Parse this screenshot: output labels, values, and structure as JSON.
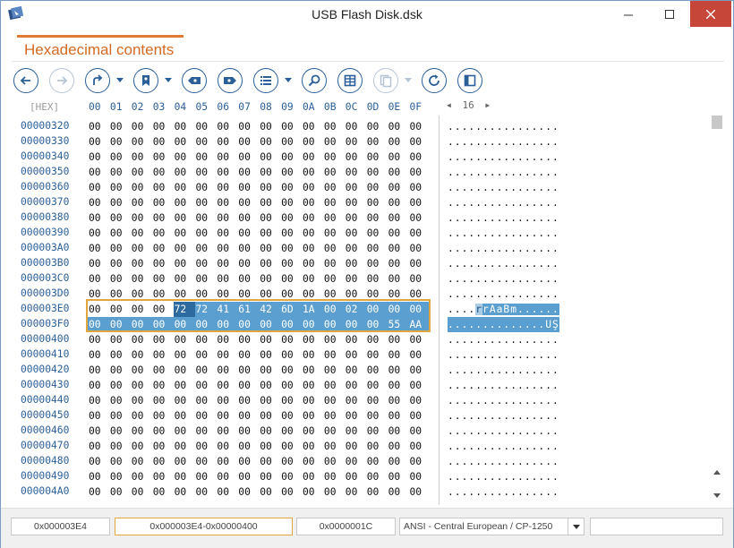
{
  "window": {
    "title": "USB Flash Disk.dsk"
  },
  "header": {
    "tab_label": "Hexadecimal contents"
  },
  "toolbar": {
    "buttons": [
      {
        "name": "back-button",
        "icon": "arrow-left-icon"
      },
      {
        "name": "forward-button",
        "icon": "arrow-right-icon",
        "disabled": true
      },
      {
        "name": "goto-button",
        "icon": "redirect-arrow-icon"
      },
      {
        "name": "bookmark-button",
        "icon": "bookmark-icon"
      },
      {
        "name": "previous-bookmark-button",
        "icon": "bookmark-prev-icon"
      },
      {
        "name": "next-bookmark-button",
        "icon": "bookmark-next-icon"
      },
      {
        "name": "list-button",
        "icon": "list-icon"
      },
      {
        "name": "find-button",
        "icon": "magnifier-icon"
      },
      {
        "name": "columns-button",
        "icon": "grid-icon"
      },
      {
        "name": "copy-button",
        "icon": "copy-icon",
        "disabled": true
      },
      {
        "name": "refresh-button",
        "icon": "refresh-icon"
      },
      {
        "name": "panel-button",
        "icon": "panel-icon"
      }
    ]
  },
  "hex": {
    "hex_label": "[HEX]",
    "columns": [
      "00",
      "01",
      "02",
      "03",
      "04",
      "05",
      "06",
      "07",
      "08",
      "09",
      "0A",
      "0B",
      "0C",
      "0D",
      "0E",
      "0F"
    ],
    "page_number": "16",
    "rows": [
      {
        "addr": "00000320",
        "bytes": [
          "00",
          "00",
          "00",
          "00",
          "00",
          "00",
          "00",
          "00",
          "00",
          "00",
          "00",
          "00",
          "00",
          "00",
          "00",
          "00"
        ],
        "ascii": "................"
      },
      {
        "addr": "00000330",
        "bytes": [
          "00",
          "00",
          "00",
          "00",
          "00",
          "00",
          "00",
          "00",
          "00",
          "00",
          "00",
          "00",
          "00",
          "00",
          "00",
          "00"
        ],
        "ascii": "................"
      },
      {
        "addr": "00000340",
        "bytes": [
          "00",
          "00",
          "00",
          "00",
          "00",
          "00",
          "00",
          "00",
          "00",
          "00",
          "00",
          "00",
          "00",
          "00",
          "00",
          "00"
        ],
        "ascii": "................"
      },
      {
        "addr": "00000350",
        "bytes": [
          "00",
          "00",
          "00",
          "00",
          "00",
          "00",
          "00",
          "00",
          "00",
          "00",
          "00",
          "00",
          "00",
          "00",
          "00",
          "00"
        ],
        "ascii": "................"
      },
      {
        "addr": "00000360",
        "bytes": [
          "00",
          "00",
          "00",
          "00",
          "00",
          "00",
          "00",
          "00",
          "00",
          "00",
          "00",
          "00",
          "00",
          "00",
          "00",
          "00"
        ],
        "ascii": "................"
      },
      {
        "addr": "00000370",
        "bytes": [
          "00",
          "00",
          "00",
          "00",
          "00",
          "00",
          "00",
          "00",
          "00",
          "00",
          "00",
          "00",
          "00",
          "00",
          "00",
          "00"
        ],
        "ascii": "................"
      },
      {
        "addr": "00000380",
        "bytes": [
          "00",
          "00",
          "00",
          "00",
          "00",
          "00",
          "00",
          "00",
          "00",
          "00",
          "00",
          "00",
          "00",
          "00",
          "00",
          "00"
        ],
        "ascii": "................"
      },
      {
        "addr": "00000390",
        "bytes": [
          "00",
          "00",
          "00",
          "00",
          "00",
          "00",
          "00",
          "00",
          "00",
          "00",
          "00",
          "00",
          "00",
          "00",
          "00",
          "00"
        ],
        "ascii": "................"
      },
      {
        "addr": "000003A0",
        "bytes": [
          "00",
          "00",
          "00",
          "00",
          "00",
          "00",
          "00",
          "00",
          "00",
          "00",
          "00",
          "00",
          "00",
          "00",
          "00",
          "00"
        ],
        "ascii": "................"
      },
      {
        "addr": "000003B0",
        "bytes": [
          "00",
          "00",
          "00",
          "00",
          "00",
          "00",
          "00",
          "00",
          "00",
          "00",
          "00",
          "00",
          "00",
          "00",
          "00",
          "00"
        ],
        "ascii": "................"
      },
      {
        "addr": "000003C0",
        "bytes": [
          "00",
          "00",
          "00",
          "00",
          "00",
          "00",
          "00",
          "00",
          "00",
          "00",
          "00",
          "00",
          "00",
          "00",
          "00",
          "00"
        ],
        "ascii": "................"
      },
      {
        "addr": "000003D0",
        "bytes": [
          "00",
          "00",
          "00",
          "00",
          "00",
          "00",
          "00",
          "00",
          "00",
          "00",
          "00",
          "00",
          "00",
          "00",
          "00",
          "00"
        ],
        "ascii": "................"
      },
      {
        "addr": "000003E0",
        "bytes": [
          "00",
          "00",
          "00",
          "00",
          "72",
          "72",
          "41",
          "61",
          "42",
          "6D",
          "1A",
          "00",
          "02",
          "00",
          "00",
          "00"
        ],
        "ascii_pre": "....",
        "ascii_cur": "r",
        "ascii_sel": "rAaBm......",
        "sel_from": 4
      },
      {
        "addr": "000003F0",
        "bytes": [
          "00",
          "00",
          "00",
          "00",
          "00",
          "00",
          "00",
          "00",
          "00",
          "00",
          "00",
          "00",
          "00",
          "00",
          "55",
          "AA"
        ],
        "ascii_sel_full": "..............UŞ",
        "sel_from": 0
      },
      {
        "addr": "00000400",
        "bytes": [
          "00",
          "00",
          "00",
          "00",
          "00",
          "00",
          "00",
          "00",
          "00",
          "00",
          "00",
          "00",
          "00",
          "00",
          "00",
          "00"
        ],
        "ascii": "................"
      },
      {
        "addr": "00000410",
        "bytes": [
          "00",
          "00",
          "00",
          "00",
          "00",
          "00",
          "00",
          "00",
          "00",
          "00",
          "00",
          "00",
          "00",
          "00",
          "00",
          "00"
        ],
        "ascii": "................"
      },
      {
        "addr": "00000420",
        "bytes": [
          "00",
          "00",
          "00",
          "00",
          "00",
          "00",
          "00",
          "00",
          "00",
          "00",
          "00",
          "00",
          "00",
          "00",
          "00",
          "00"
        ],
        "ascii": "................"
      },
      {
        "addr": "00000430",
        "bytes": [
          "00",
          "00",
          "00",
          "00",
          "00",
          "00",
          "00",
          "00",
          "00",
          "00",
          "00",
          "00",
          "00",
          "00",
          "00",
          "00"
        ],
        "ascii": "................"
      },
      {
        "addr": "00000440",
        "bytes": [
          "00",
          "00",
          "00",
          "00",
          "00",
          "00",
          "00",
          "00",
          "00",
          "00",
          "00",
          "00",
          "00",
          "00",
          "00",
          "00"
        ],
        "ascii": "................"
      },
      {
        "addr": "00000450",
        "bytes": [
          "00",
          "00",
          "00",
          "00",
          "00",
          "00",
          "00",
          "00",
          "00",
          "00",
          "00",
          "00",
          "00",
          "00",
          "00",
          "00"
        ],
        "ascii": "................"
      },
      {
        "addr": "00000460",
        "bytes": [
          "00",
          "00",
          "00",
          "00",
          "00",
          "00",
          "00",
          "00",
          "00",
          "00",
          "00",
          "00",
          "00",
          "00",
          "00",
          "00"
        ],
        "ascii": "................"
      },
      {
        "addr": "00000470",
        "bytes": [
          "00",
          "00",
          "00",
          "00",
          "00",
          "00",
          "00",
          "00",
          "00",
          "00",
          "00",
          "00",
          "00",
          "00",
          "00",
          "00"
        ],
        "ascii": "................"
      },
      {
        "addr": "00000480",
        "bytes": [
          "00",
          "00",
          "00",
          "00",
          "00",
          "00",
          "00",
          "00",
          "00",
          "00",
          "00",
          "00",
          "00",
          "00",
          "00",
          "00"
        ],
        "ascii": "................"
      },
      {
        "addr": "00000490",
        "bytes": [
          "00",
          "00",
          "00",
          "00",
          "00",
          "00",
          "00",
          "00",
          "00",
          "00",
          "00",
          "00",
          "00",
          "00",
          "00",
          "00"
        ],
        "ascii": "................"
      },
      {
        "addr": "000004A0",
        "bytes": [
          "00",
          "00",
          "00",
          "00",
          "00",
          "00",
          "00",
          "00",
          "00",
          "00",
          "00",
          "00",
          "00",
          "00",
          "00",
          "00"
        ],
        "ascii": "................"
      }
    ]
  },
  "status": {
    "offset": "0x000003E4",
    "selection_range": "0x000003E4-0x00000400",
    "selection_length": "0x0000001C",
    "encoding": "ANSI - Central European / CP-1250",
    "extra": ""
  },
  "colors": {
    "accent": "#2a5f98",
    "tab_accent": "#e07a36",
    "selection": "#5b9fd0",
    "outline": "#e0a640"
  }
}
